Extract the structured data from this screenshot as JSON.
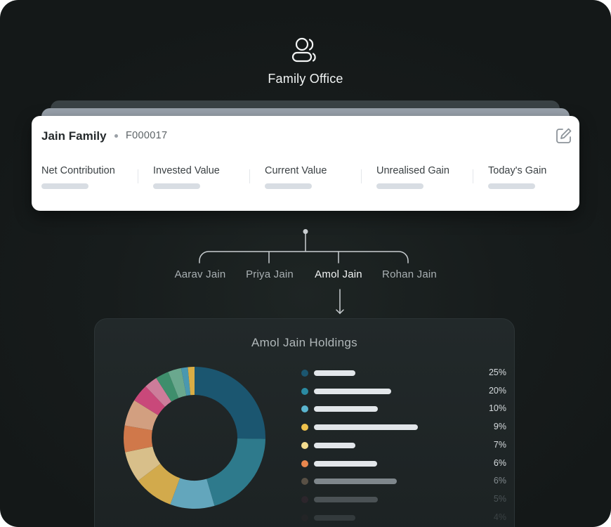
{
  "header": {
    "title": "Family Office",
    "icon": "users-icon"
  },
  "family_card": {
    "name": "Jain Family",
    "code": "F000017",
    "edit_icon": "edit-icon",
    "metrics": [
      {
        "label": "Net Contribution"
      },
      {
        "label": "Invested Value"
      },
      {
        "label": "Current Value"
      },
      {
        "label": "Unrealised Gain"
      },
      {
        "label": "Today's Gain"
      }
    ]
  },
  "members": [
    {
      "name": "Aarav Jain",
      "active": false
    },
    {
      "name": "Priya Jain",
      "active": false
    },
    {
      "name": "Amol Jain",
      "active": true
    },
    {
      "name": "Rohan Jain",
      "active": false
    }
  ],
  "holdings": {
    "title": "Amol Jain Holdings",
    "legend": [
      {
        "pct": "25%",
        "color": "#1b5670"
      },
      {
        "pct": "20%",
        "color": "#2a8aa2"
      },
      {
        "pct": "10%",
        "color": "#5bb5cf"
      },
      {
        "pct": "9%",
        "color": "#efc24c"
      },
      {
        "pct": "7%",
        "color": "#f3dc8f"
      },
      {
        "pct": "6%",
        "color": "#e9874e"
      },
      {
        "pct": "6%",
        "color": "#8a7560"
      },
      {
        "pct": "5%",
        "color": "#4a2c39"
      },
      {
        "pct": "4%",
        "color": "#3a2931"
      }
    ]
  },
  "chart_data": {
    "type": "pie",
    "slices": [
      {
        "value": 25,
        "color": "#1b5670"
      },
      {
        "value": 20,
        "color": "#2e7a8c"
      },
      {
        "value": 10,
        "color": "#63a6bc"
      },
      {
        "value": 9,
        "color": "#d2aa4c"
      },
      {
        "value": 7,
        "color": "#d8bf8a"
      },
      {
        "value": 6,
        "color": "#d0784a"
      },
      {
        "value": 6,
        "color": "#d29f80"
      },
      {
        "value": 4,
        "color": "#c9487a"
      },
      {
        "value": 3,
        "color": "#cd7c9a"
      },
      {
        "value": 3,
        "color": "#3e8e6c"
      },
      {
        "value": 3,
        "color": "#6aa88e"
      },
      {
        "value": 1.5,
        "color": "#4a98b0"
      },
      {
        "value": 1.5,
        "color": "#d9ad45"
      }
    ]
  }
}
